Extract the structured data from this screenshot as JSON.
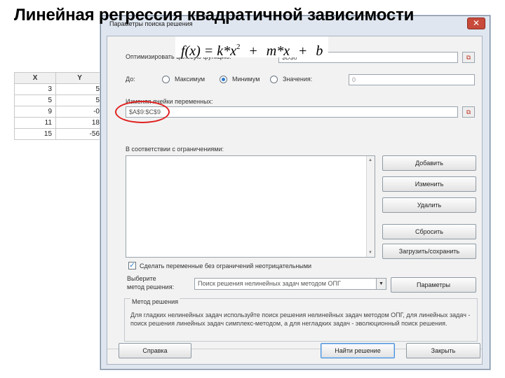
{
  "slide": {
    "title": "Линейная регрессия квадратичной зависимости"
  },
  "spreadsheet": {
    "headers": [
      "X",
      "Y"
    ],
    "rows": [
      [
        "3",
        "5"
      ],
      [
        "5",
        "5"
      ],
      [
        "9",
        "-0"
      ],
      [
        "11",
        "18"
      ],
      [
        "15",
        "-56"
      ]
    ]
  },
  "formula": {
    "lhs": "f(x) = k*x",
    "power": "2",
    "op1": "+",
    "term2": "m*x",
    "op2": "+",
    "term3": "b"
  },
  "dialog": {
    "title": "Параметры поиска решения",
    "close_glyph": "✕",
    "objective_label": "Оптимизировать целевую функцию:",
    "objective_value": "$D$8",
    "to_label": "До:",
    "radio_max": "Максимум",
    "radio_min": "Минимум",
    "radio_value": "Значения:",
    "value_field": "0",
    "changing_label": "Изменяя ячейки переменных:",
    "changing_value": "$A$9:$C$9",
    "constraints_label": "В соответствии с ограничениями:",
    "btn_add": "Добавить",
    "btn_change": "Изменить",
    "btn_delete": "Удалить",
    "btn_reset": "Сбросить",
    "btn_load_save": "Загрузить/сохранить",
    "checkbox_label": "Сделать переменные без ограничений неотрицательными",
    "method_label_line1": "Выберите",
    "method_label_line2": "метод решения:",
    "method_value": "Поиск решения нелинейных задач методом ОПГ",
    "btn_params": "Параметры",
    "method_group_title": "Метод решения",
    "method_description": "Для гладких нелинейных задач используйте поиск решения нелинейных задач методом ОПГ, для линейных задач - поиск решения линейных задач симплекс-методом, а для негладких задач - эволюционный поиск решения.",
    "btn_help": "Справка",
    "btn_solve": "Найти решение",
    "btn_close": "Закрыть",
    "ref_glyph": "⧉"
  }
}
